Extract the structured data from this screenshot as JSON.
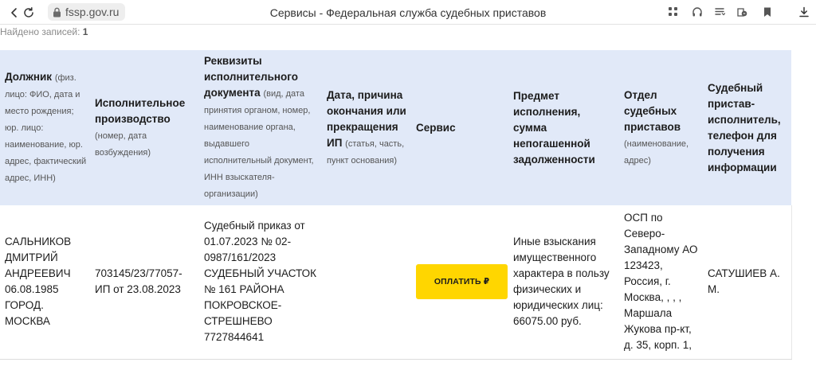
{
  "browser": {
    "url": "fssp.gov.ru",
    "tab_title": "Сервисы - Федеральная служба судебных приставов",
    "icons": [
      "back-icon",
      "reload-icon",
      "lock-icon",
      "apps-icon",
      "headphones-icon",
      "bookmarks-list-icon",
      "privacy-icon",
      "bookmark-icon",
      "downloads-icon"
    ]
  },
  "results": {
    "records_label": "Найдено записей:",
    "records_count": "1",
    "columns": [
      {
        "title": "Должник",
        "hint": "(физ. лицо: ФИО, дата и место рождения; юр. лицо: наименование, юр. адрес, фактический адрес, ИНН)"
      },
      {
        "title": "Исполнительное производство",
        "hint": "(номер, дата возбуждения)"
      },
      {
        "title": "Реквизиты исполнительного документа",
        "hint": "(вид, дата принятия органом, номер, наименование органа, выдавшего исполнительный документ, ИНН взыскателя-организации)"
      },
      {
        "title": "Дата, причина окончания или прекращения ИП",
        "hint": "(статья, часть, пункт основания)"
      },
      {
        "title": "Сервис",
        "hint": ""
      },
      {
        "title": "Предмет исполнения, сумма непогашенной задолженности",
        "hint": ""
      },
      {
        "title": "Отдел судебных приставов",
        "hint": "(наименование, адрес)"
      },
      {
        "title": "Судебный пристав-исполнитель, телефон для получения информации",
        "hint": ""
      }
    ],
    "rows": [
      {
        "debtor": "САЛЬНИКОВ ДМИТРИЙ АНДРЕЕВИЧ 06.08.1985 ГОРОД. МОСКВА",
        "proceeding": "703145/23/77057-ИП от 23.08.2023",
        "document": "Судебный приказ от 01.07.2023 № 02-0987/161/2023 СУДЕБНЫЙ УЧАСТОК № 161 РАЙОНА ПОКРОВСКОЕ-СТРЕШНЕВО 7727844641",
        "end_reason": "",
        "pay_button": "ОПЛАТИТЬ ₽",
        "subject": "Иные взыскания имущественного характера в пользу физических и юридических лиц: 66075.00 руб.",
        "department": "ОСП по Северо-Западному АО 123423, Россия, г. Москва, , , , Маршала Жукова пр-кт, д. 35, корп. 1,",
        "bailiff": "САТУШИЕВ А. М."
      }
    ]
  },
  "colors": {
    "header_bg": "#e1e9f8",
    "pay_button_bg": "#ffd600",
    "url_pill_bg": "#eeeeee"
  }
}
